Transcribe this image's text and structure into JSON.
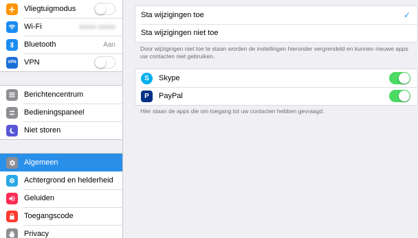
{
  "sidebar": {
    "group1": [
      {
        "label": "Vliegtuigmodus",
        "icon": "airplane-icon",
        "color": "#ff9500",
        "switch": "off"
      },
      {
        "label": "Wi-Fi",
        "icon": "wifi-icon",
        "color": "#1a8cf0",
        "value": "xxxxx xxxxx"
      },
      {
        "label": "Bluetooth",
        "icon": "bluetooth-icon",
        "color": "#1a8cf0",
        "value": "Aan"
      },
      {
        "label": "VPN",
        "icon": "vpn-icon",
        "color": "#1a6fd8",
        "icon_text": "VPN",
        "switch": "off"
      }
    ],
    "group2": [
      {
        "label": "Berichtencentrum",
        "icon": "notification-center-icon",
        "color": "#8e8e93"
      },
      {
        "label": "Bedieningspaneel",
        "icon": "control-center-icon",
        "color": "#8e8e93"
      },
      {
        "label": "Niet storen",
        "icon": "moon-icon",
        "color": "#5856d6"
      }
    ],
    "group3": [
      {
        "label": "Algemeen",
        "icon": "gear-icon",
        "color": "#8e8e93",
        "selected": true
      },
      {
        "label": "Achtergrond en helderheid",
        "icon": "flower-icon",
        "color": "#2aa8e8"
      },
      {
        "label": "Geluiden",
        "icon": "speaker-icon",
        "color": "#ff2d55"
      },
      {
        "label": "Toegangscode",
        "icon": "lock-icon",
        "color": "#ff3b30"
      },
      {
        "label": "Privacy",
        "icon": "hand-icon",
        "color": "#8e8e93"
      }
    ]
  },
  "main": {
    "options": [
      {
        "label": "Sta wijzigingen toe",
        "checked": true,
        "check_glyph": "✓"
      },
      {
        "label": "Sta wijzigingen niet toe",
        "checked": false
      }
    ],
    "options_note": "Door wijzigingen niet toe te staan worden de instellingen hieronder vergrendeld en kunnen nieuwe apps uw contacten niet gebruiken.",
    "apps": [
      {
        "label": "Skype",
        "icon": "skype-icon",
        "color": "#00aff0",
        "icon_text": "S",
        "switch": "on"
      },
      {
        "label": "PayPal",
        "icon": "paypal-icon",
        "color": "#003087",
        "icon_text": "P",
        "switch": "on"
      }
    ],
    "apps_note": "Hier staan de apps die om toegang tot uw contacten hebben gevraagd."
  }
}
